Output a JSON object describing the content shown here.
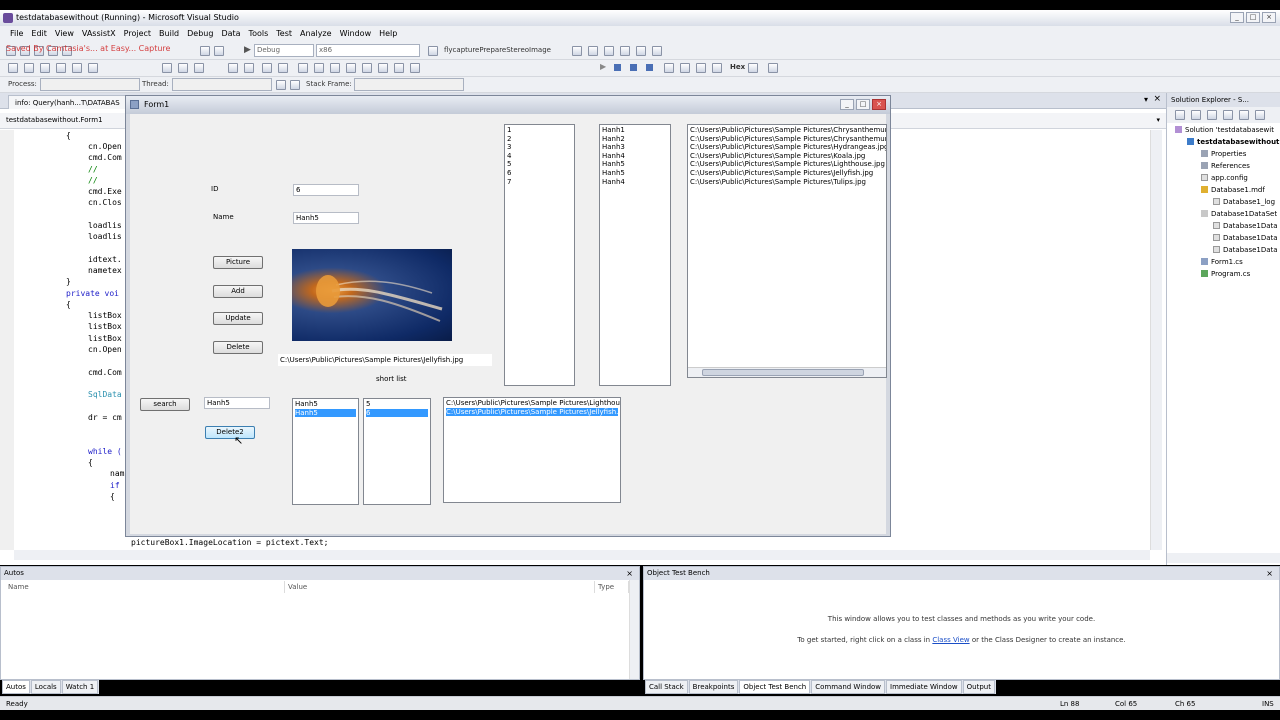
{
  "app": {
    "title": "testdatabasewithout (Running) - Microsoft Visual Studio"
  },
  "menu": [
    "File",
    "Edit",
    "View",
    "VAssistX",
    "Project",
    "Build",
    "Debug",
    "Data",
    "Tools",
    "Test",
    "Analyze",
    "Window",
    "Help"
  ],
  "overlay_text": "Saved By Camtasia's... at Easy... Capture",
  "toolbar": {
    "config": "Debug",
    "platform": "x86",
    "startup_label": "flycapturePrepareStereoImage",
    "hex_label": "Hex",
    "process_label": "Process:",
    "thread_label": "Thread:",
    "stackframe_label": "Stack Frame:"
  },
  "doc_tabs": {
    "info_tab": "info: Query(hanh...T\\DATABAS",
    "nav": "testdatabasewithout.Form1"
  },
  "code_lines": [
    "{",
    "cn.Open",
    "cmd.Com",
    "//",
    "//",
    "cmd.Exe",
    "cn.Clos",
    "loadlis",
    "loadlis",
    "idtext.",
    "nametex",
    "}",
    "private voi",
    "{",
    "listBox",
    "listBox",
    "listBox",
    "cn.Open",
    "cmd.Com",
    "SqlData",
    "dr = cm",
    "while (",
    "{",
    "nam",
    "if",
    "{",
    "pictureBox1.ImageLocation = pictext.Text;"
  ],
  "form1": {
    "title": "Form1",
    "id_label": "ID",
    "id_value": "6",
    "name_label": "Name",
    "name_value": "Hanh5",
    "picture_button": "Picture",
    "add_button": "Add",
    "update_button": "Update",
    "delete_button": "Delete",
    "image_path": "C:\\Users\\Public\\Pictures\\Sample Pictures\\Jellyfish.jpg",
    "short_list_label": "short list",
    "search_button": "search",
    "search_value": "Hanh5",
    "delete2_button": "Delete2",
    "ids_list": [
      "1",
      "2",
      "3",
      "4",
      "5",
      "6",
      "7"
    ],
    "names_list": [
      "Hanh1",
      "Hanh2",
      "Hanh3",
      "Hanh4",
      "Hanh5",
      "Hanh5",
      "Hanh4"
    ],
    "paths_list": [
      "C:\\Users\\Public\\Pictures\\Sample Pictures\\Chrysanthemum.jpg",
      "C:\\Users\\Public\\Pictures\\Sample Pictures\\Chrysanthemum.jpg",
      "C:\\Users\\Public\\Pictures\\Sample Pictures\\Hydrangeas.jpg",
      "C:\\Users\\Public\\Pictures\\Sample Pictures\\Koala.jpg",
      "C:\\Users\\Public\\Pictures\\Sample Pictures\\Lighthouse.jpg",
      "C:\\Users\\Public\\Pictures\\Sample Pictures\\Jellyfish.jpg",
      "C:\\Users\\Public\\Pictures\\Sample Pictures\\Tulips.jpg"
    ],
    "short_names": [
      "Hanh5",
      "Hanh5"
    ],
    "short_ids": [
      "5",
      "6"
    ],
    "short_paths": [
      "C:\\Users\\Public\\Pictures\\Sample Pictures\\Lighthouse.j",
      "C:\\Users\\Public\\Pictures\\Sample Pictures\\Jellyfish.jpg"
    ]
  },
  "solution_explorer": {
    "title": "Solution Explorer - S...",
    "items": [
      "Solution 'testdatabasewit",
      "testdatabasewithout",
      "Properties",
      "References",
      "app.config",
      "Database1.mdf",
      "Database1_log",
      "Database1DataSet",
      "Database1Data",
      "Database1Data",
      "Database1Data",
      "Form1.cs",
      "Program.cs"
    ]
  },
  "autos": {
    "title": "Autos",
    "col_name": "Name",
    "col_value": "Value",
    "col_type": "Type"
  },
  "otb": {
    "title": "Object Test Bench",
    "msg1": "This window allows you to test classes and methods as you write your code.",
    "msg2_pre": "To get started, right click on a class in",
    "msg2_link": "Class View",
    "msg2_post": "or the Class Designer to create an instance."
  },
  "bottom_tabs_left": [
    "Autos",
    "Locals",
    "Watch 1"
  ],
  "bottom_tabs_right": [
    "Call Stack",
    "Breakpoints",
    "Object Test Bench",
    "Command Window",
    "Immediate Window",
    "Output"
  ],
  "status": {
    "ready": "Ready",
    "ln": "Ln 88",
    "col": "Col 65",
    "ch": "Ch 65",
    "ins": "INS"
  }
}
